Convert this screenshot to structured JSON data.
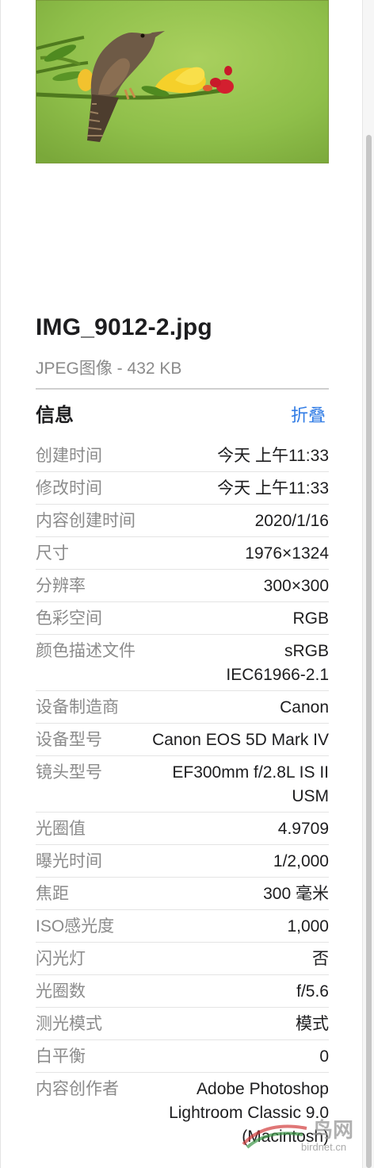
{
  "file": {
    "name": "IMG_9012-2.jpg",
    "type_size": "JPEG图像 - 432 KB"
  },
  "info": {
    "title": "信息",
    "collapse_label": "折叠",
    "rows": [
      {
        "label": "创建时间",
        "value": "今天 上午11:33"
      },
      {
        "label": "修改时间",
        "value": "今天 上午11:33"
      },
      {
        "label": "内容创建时间",
        "value": "2020/1/16"
      },
      {
        "label": "尺寸",
        "value": "1976×1324"
      },
      {
        "label": "分辨率",
        "value": "300×300"
      },
      {
        "label": "色彩空间",
        "value": "RGB"
      },
      {
        "label": "颜色描述文件",
        "value": "sRGB IEC61966-2.1"
      },
      {
        "label": "设备制造商",
        "value": "Canon"
      },
      {
        "label": "设备型号",
        "value": "Canon EOS 5D Mark IV"
      },
      {
        "label": "镜头型号",
        "value": "EF300mm f/2.8L IS II USM"
      },
      {
        "label": "光圈值",
        "value": "4.9709"
      },
      {
        "label": "曝光时间",
        "value": "1/2,000"
      },
      {
        "label": "焦距",
        "value": "300 毫米"
      },
      {
        "label": "ISO感光度",
        "value": "1,000"
      },
      {
        "label": "闪光灯",
        "value": "否"
      },
      {
        "label": "光圈数",
        "value": "f/5.6"
      },
      {
        "label": "测光模式",
        "value": "模式"
      },
      {
        "label": "白平衡",
        "value": "0"
      },
      {
        "label": "内容创作者",
        "value": "Adobe Photoshop Lightroom Classic 9.0 (Macintosh)"
      }
    ]
  },
  "watermark": {
    "text_cn": "鸟网",
    "url": "birdnet.cn"
  },
  "colors": {
    "link": "#2f7be5",
    "label": "#8b8b8b",
    "value": "#1d1d1f",
    "preview_bg": "#8fbf4a"
  },
  "icons": {
    "watermark_logo": "swoosh-logo"
  }
}
